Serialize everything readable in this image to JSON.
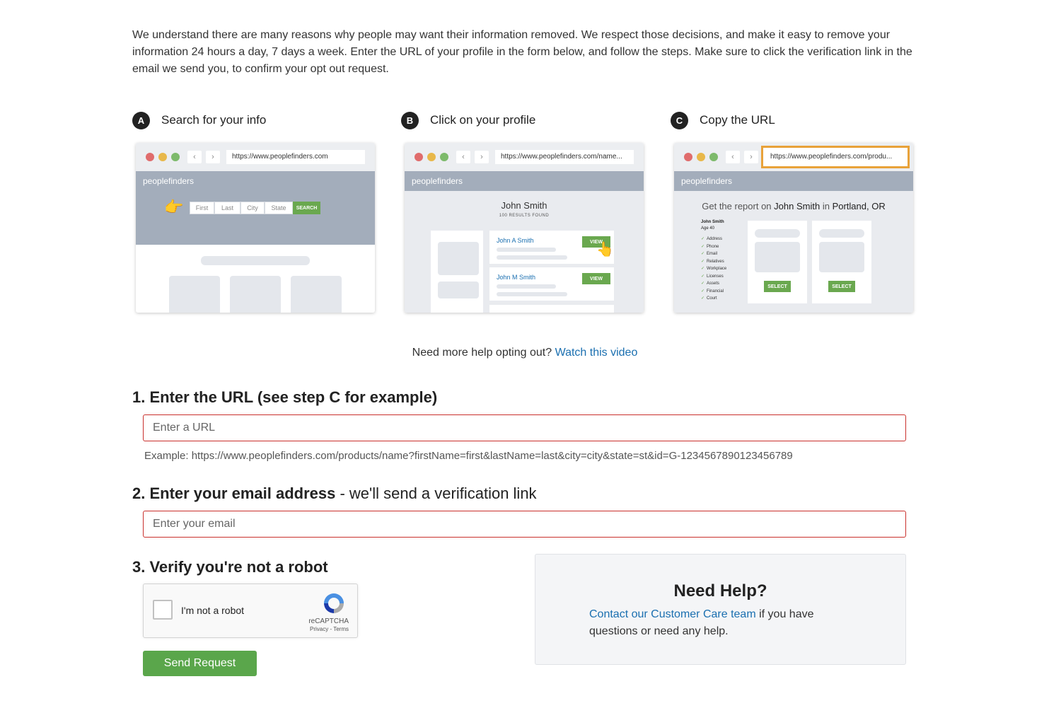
{
  "intro": "We understand there are many reasons why people may want their information removed. We respect those decisions, and make it easy to remove your information 24 hours a day, 7 days a week. Enter the URL of your profile in the form below, and follow the steps. Make sure to click the verification link in the email we send you, to confirm your opt out request.",
  "steps": [
    {
      "badge": "A",
      "title": "Search for your info",
      "url": "https://www.peoplefinders.com",
      "brand": "peoplefinders",
      "search_fields": [
        "First",
        "Last",
        "City",
        "State"
      ],
      "search_button": "SEARCH"
    },
    {
      "badge": "B",
      "title": "Click on your profile",
      "url": "https://www.peoplefinders.com/name...",
      "brand": "peoplefinders",
      "name": "John Smith",
      "results": "100 RESULTS FOUND",
      "result_items": [
        {
          "name": "John A Smith",
          "button": "VIEW"
        },
        {
          "name": "John M Smith",
          "button": "VIEW"
        }
      ]
    },
    {
      "badge": "C",
      "title": "Copy the URL",
      "url": "https://www.peoplefinders.com/produ...",
      "brand": "peoplefinders",
      "report_prefix": "Get the report on",
      "report_name": "John Smith",
      "report_in": "in",
      "report_place": "Portland, OR",
      "person_name": "John Smith",
      "person_age": "Age 40",
      "checklist": [
        "Address",
        "Phone",
        "Email",
        "Relatives",
        "Workplace",
        "Licenses",
        "Assets",
        "Financial",
        "Court"
      ],
      "select_button": "SELECT"
    }
  ],
  "video_help": {
    "text": "Need more help opting out?",
    "link": "Watch this video"
  },
  "form": {
    "url_heading": "1. Enter the URL (see step C for example)",
    "url_placeholder": "Enter a URL",
    "url_example": "Example: https://www.peoplefinders.com/products/name?firstName=first&lastName=last&city=city&state=st&id=G-1234567890123456789",
    "email_heading_bold": "2. Enter your email address",
    "email_heading_rest": " - we'll send a verification link",
    "email_placeholder": "Enter your email",
    "robot_heading": "3. Verify you're not a robot",
    "recaptcha_label": "I'm not a robot",
    "recaptcha_brand": "reCAPTCHA",
    "recaptcha_terms": "Privacy - Terms",
    "send_button": "Send Request"
  },
  "help": {
    "title": "Need Help?",
    "link": "Contact our Customer Care team",
    "text": " if you have questions or need any help."
  },
  "colors": {
    "link": "#1a6fb0",
    "button_green": "#5aa64b",
    "error_border": "#c9302c",
    "highlight": "#e8a23a"
  }
}
